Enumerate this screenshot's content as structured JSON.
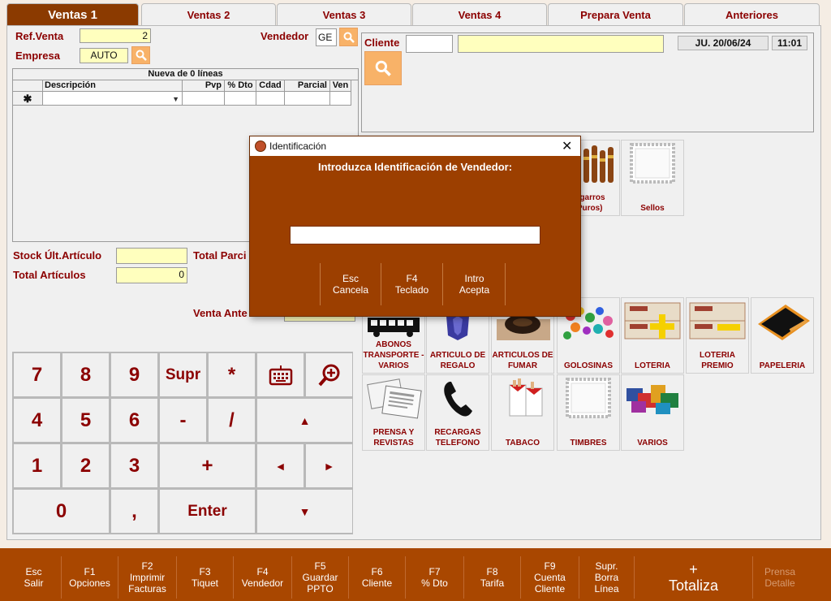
{
  "tabs": [
    "Ventas 1",
    "Ventas 2",
    "Ventas 3",
    "Ventas 4",
    "Prepara Venta",
    "Anteriores"
  ],
  "header": {
    "ref_venta_label": "Ref.Venta",
    "ref_venta_value": "2",
    "empresa_label": "Empresa",
    "empresa_value": "AUTO",
    "vendedor_label": "Vendedor",
    "vendedor_value": "GE",
    "cliente_label": "Cliente",
    "cliente_code": "",
    "cliente_name": "",
    "date": "JU. 20/06/24",
    "time": "11:01"
  },
  "lines_grid": {
    "title": "Nueva de 0 líneas",
    "columns": [
      "Descripción",
      "Pvp",
      "% Dto",
      "Cdad",
      "Parcial",
      "Ven"
    ],
    "new_row_marker": "✱"
  },
  "totals": {
    "stock_label": "Stock Últ.Artículo",
    "stock_value": "",
    "total_articulos_label": "Total Artículos",
    "total_articulos_value": "0",
    "total_parcial_label": "Total Parci",
    "venta_anterior_label": "Venta Ante"
  },
  "keypad": {
    "k7": "7",
    "k8": "8",
    "k9": "9",
    "supr": "Supr",
    "star": "*",
    "k4": "4",
    "k5": "5",
    "k6": "6",
    "minus": "-",
    "slash": "/",
    "k1": "1",
    "k2": "2",
    "k3": "3",
    "plus": "+",
    "k0": "0",
    "comma": ",",
    "enter": "Enter",
    "up": "▲",
    "left": "◄",
    "right": "►",
    "down": "▼"
  },
  "categories_top": [
    {
      "label": "Cigarros (Puros)",
      "icon": "cigar-icon"
    },
    {
      "label": "Sellos",
      "icon": "stamp-icon"
    }
  ],
  "categories": [
    {
      "label": "ABONOS TRANSPORTE - VARIOS",
      "icon": "bus-icon"
    },
    {
      "label": "ARTICULO DE REGALO",
      "icon": "gift-icon"
    },
    {
      "label": "ARTICULOS DE FUMAR",
      "icon": "smoking-icon"
    },
    {
      "label": "GOLOSINAS",
      "icon": "candy-icon"
    },
    {
      "label": "LOTERIA",
      "icon": "lottery-icon"
    },
    {
      "label": "LOTERIA PREMIO",
      "icon": "lottery-prize-icon"
    },
    {
      "label": "PAPELERIA",
      "icon": "stationery-icon"
    },
    {
      "label": "PRENSA Y REVISTAS",
      "icon": "newspaper-icon"
    },
    {
      "label": "RECARGAS TELEFONO",
      "icon": "phone-icon"
    },
    {
      "label": "TABACO",
      "icon": "tobacco-icon"
    },
    {
      "label": "TIMBRES",
      "icon": "stamp-icon"
    },
    {
      "label": "VARIOS",
      "icon": "misc-icon"
    }
  ],
  "dialog": {
    "title": "Identificación",
    "prompt": "Introduzca Identificación de Vendedor:",
    "input_value": "",
    "buttons": [
      {
        "key": "Esc",
        "label": "Cancela"
      },
      {
        "key": "F4",
        "label": "Teclado"
      },
      {
        "key": "Intro",
        "label": "Acepta"
      }
    ]
  },
  "function_bar": [
    {
      "key": "Esc",
      "label": "Salir"
    },
    {
      "key": "F1",
      "label": "Opciones"
    },
    {
      "key": "F2",
      "label": "Imprimir Facturas"
    },
    {
      "key": "F3",
      "label": "Tiquet"
    },
    {
      "key": "F4",
      "label": "Vendedor"
    },
    {
      "key": "F5",
      "label": "Guardar PPTO"
    },
    {
      "key": "F6",
      "label": "Cliente"
    },
    {
      "key": "F7",
      "label": "% Dto"
    },
    {
      "key": "F8",
      "label": "Tarifa"
    },
    {
      "key": "F9",
      "label": "Cuenta Cliente"
    },
    {
      "key": "Supr.",
      "label": "Borra Línea"
    },
    {
      "key": "+",
      "label": "Totaliza"
    },
    {
      "key": "Prensa",
      "label": "Detalle"
    }
  ],
  "colors": {
    "accent": "#8b3a00",
    "text_dark_red": "#8b0000",
    "field_yellow": "#ffffbe",
    "search_orange": "#f8b268",
    "function_bar": "#a94700"
  }
}
